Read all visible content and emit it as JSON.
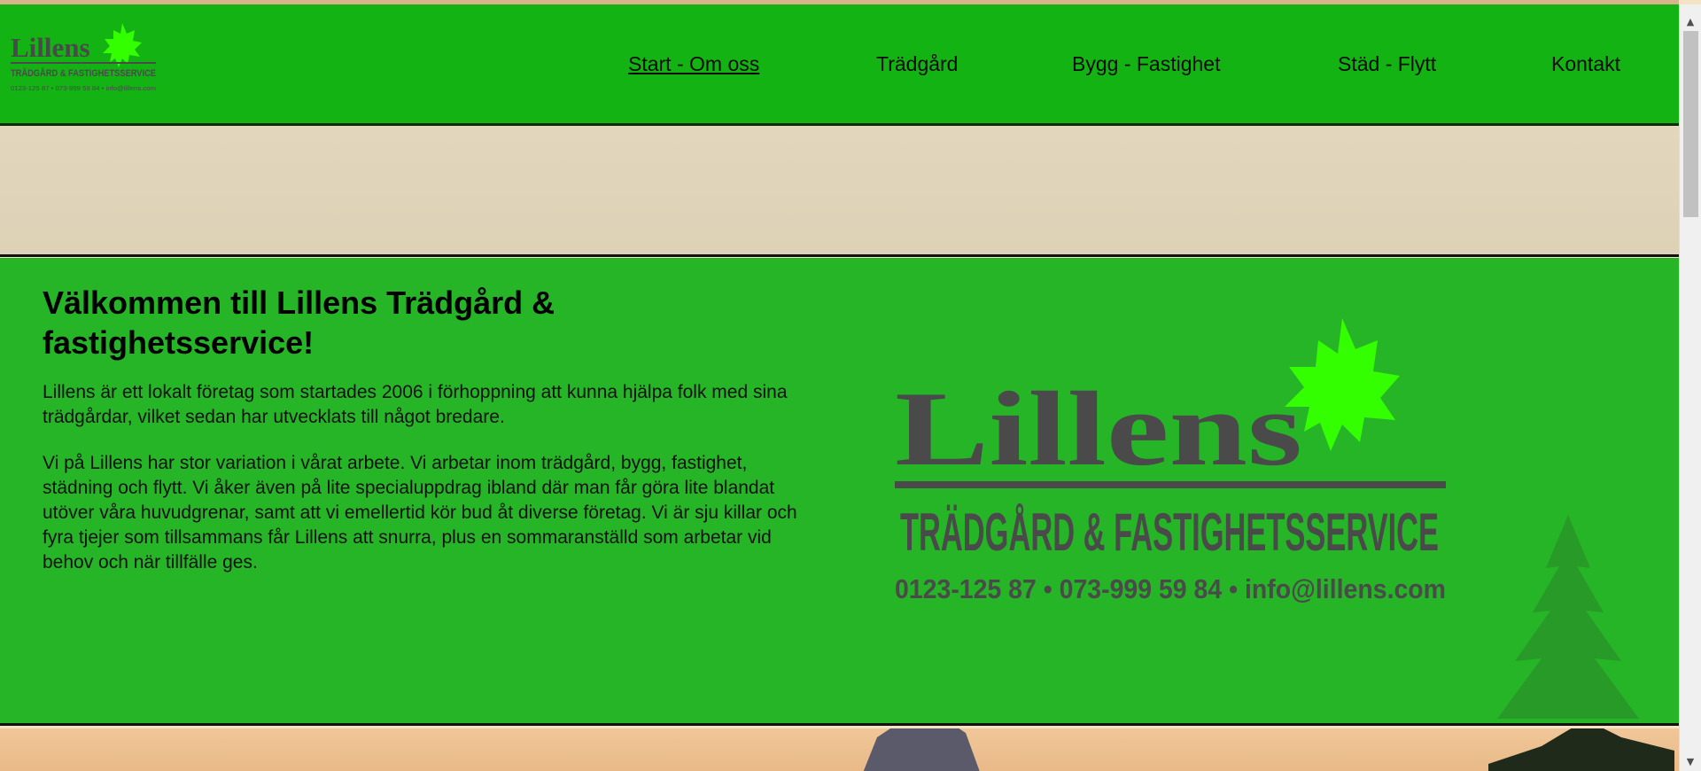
{
  "header": {
    "logo_alt": "Lillens Trädgård & Fastighetsservice logo",
    "logo": {
      "name": "Lillens",
      "tagline": "TRÄDGÅRD & FASTIGHETSSERVICE",
      "contact": "0123-125 87 • 073-999 59 84 • info@lillens.com"
    },
    "nav": [
      {
        "label": "Start - Om oss",
        "active": true
      },
      {
        "label": "Trädgård",
        "active": false
      },
      {
        "label": "Bygg - Fastighet",
        "active": false
      },
      {
        "label": "Städ - Flytt",
        "active": false
      },
      {
        "label": "Kontakt",
        "active": false
      }
    ]
  },
  "main": {
    "title": "Välkommen till Lillens Trädgård & fastighetsservice!",
    "paragraphs": [
      "Lillens är ett lokalt företag som startades 2006 i förhoppning att kunna hjälpa folk med sina trädgårdar, vilket sedan har utvecklats till något bredare.",
      "Vi på Lillens har stor variation i vårat arbete. Vi arbetar inom trädgård, bygg, fastighet, städning och flytt. Vi åker även på lite specialuppdrag ibland där man får göra lite blandat utöver våra huvudgrenar, samt att vi emellertid kör bud åt diverse företag. Vi är sju killar och fyra tjejer som tillsammans får Lillens att snurra, plus en sommaranställd som arbetar vid behov och när tillfälle ges."
    ]
  },
  "colors": {
    "header_green": "#12b312",
    "main_green": "#26b526",
    "leaf_green": "#33ff00",
    "logo_gray": "#4a4a4a"
  },
  "icons": {
    "scroll_up": "scroll-up-arrow-icon",
    "scroll_down": "scroll-down-arrow-icon"
  }
}
